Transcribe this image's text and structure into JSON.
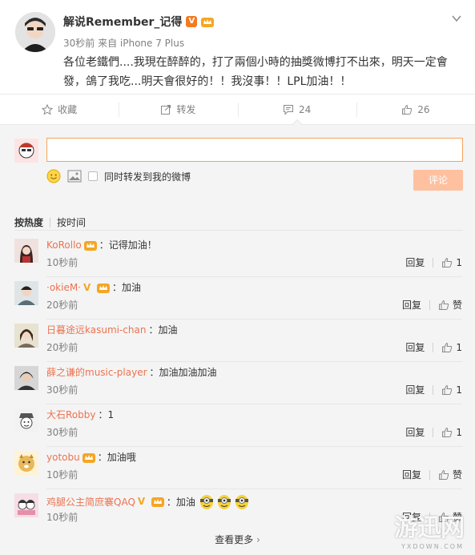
{
  "post": {
    "nickname": "解说Remember_记得",
    "verified_badge": "V",
    "meta": "30秒前 来自 iPhone 7 Plus",
    "text": "各位老鐵們....我現在醉醉的，打了兩個小時的抽獎微博打不出來，明天一定會發，鴿了我吃...明天會很好的！！我沒事！！LPL加油！！",
    "icons": {
      "more": "chevron-down-icon",
      "crown": "crown-badge-icon"
    }
  },
  "actions": [
    {
      "icon": "star-icon",
      "label": "收藏"
    },
    {
      "icon": "share-icon",
      "label": "转发"
    },
    {
      "icon": "comment-icon",
      "label": "24"
    },
    {
      "icon": "thumb-up-icon",
      "label": "26"
    }
  ],
  "composer": {
    "input_value": "",
    "sync_label": "同时转发到我的微博",
    "submit_label": "评论",
    "accent": "#f7a35c",
    "submit_color": "#ffc09f"
  },
  "sort": {
    "hot": "按热度",
    "time": "按时间"
  },
  "comments": [
    {
      "name": "KoRollo",
      "badges": [
        "crown"
      ],
      "text": "：记得加油！",
      "time": "10秒前",
      "reply": "回复",
      "likes": "1"
    },
    {
      "name": "·okieM·",
      "badges": [
        "v-yellow",
        "crown"
      ],
      "text": "：加油",
      "time": "20秒前",
      "reply": "回复",
      "likes": "赞"
    },
    {
      "name": "日暮途远kasumi-chan",
      "badges": [],
      "text": "：加油",
      "time": "20秒前",
      "reply": "回复",
      "likes": "1"
    },
    {
      "name": "薛之谦的music-player",
      "badges": [],
      "text": "：加油加油加油",
      "time": "30秒前",
      "reply": "回复",
      "likes": "1"
    },
    {
      "name": "大石Robby",
      "badges": [],
      "text": "：1",
      "time": "30秒前",
      "reply": "回复",
      "likes": "1"
    },
    {
      "name": "yotobu",
      "badges": [
        "crown"
      ],
      "text": "：加油哦",
      "time": "10秒前",
      "reply": "回复",
      "likes": "赞"
    },
    {
      "name": "鸡腿公主简庶褰QAQ",
      "badges": [
        "v-yellow",
        "crown"
      ],
      "text": "：加油",
      "time": "10秒前",
      "reply": "回复",
      "likes": "赞"
    }
  ],
  "see_more": "查看更多",
  "watermark": {
    "brand": "游迅网",
    "domain": "YXDOWN.COM"
  },
  "colors": {
    "name_link": "#eb7350",
    "v_badge": "#f47a1f",
    "crown": "#f5a623"
  }
}
